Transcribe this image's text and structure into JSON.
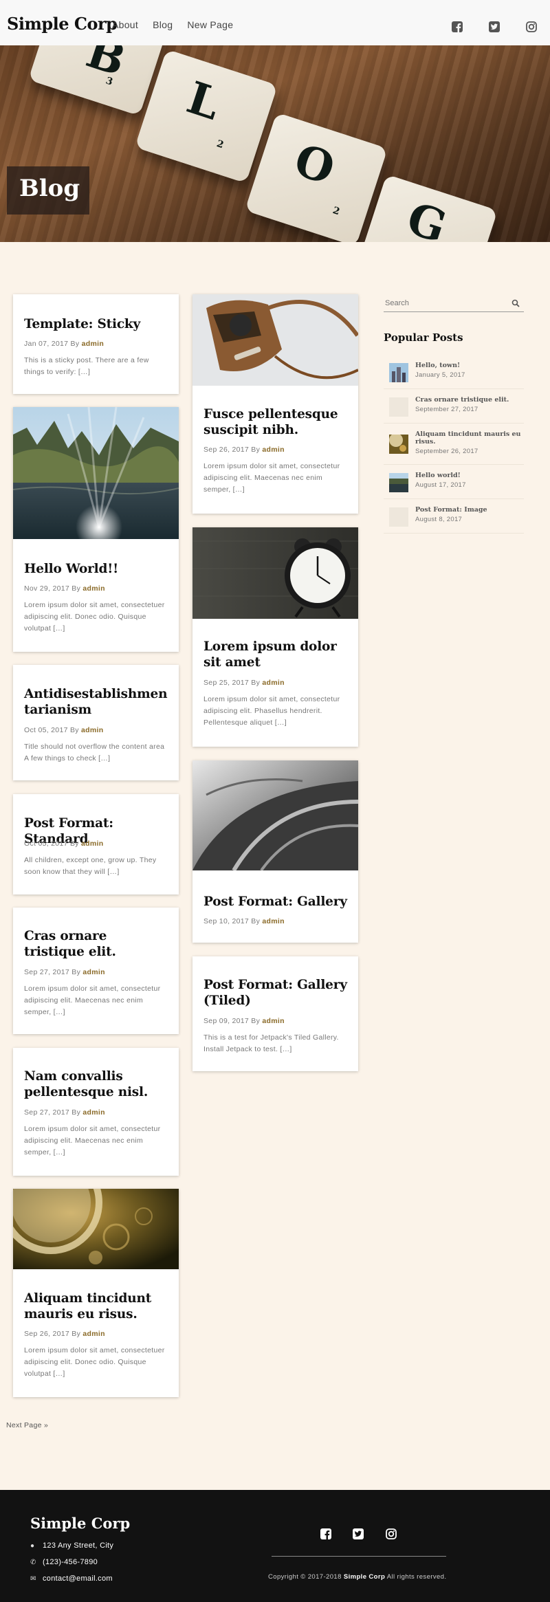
{
  "header": {
    "brand": "Simple Corp",
    "nav": [
      "About",
      "Blog",
      "New Page"
    ],
    "social_icons": [
      "facebook-icon",
      "twitter-icon",
      "instagram-icon"
    ]
  },
  "hero": {
    "title": "Blog",
    "tile_letters": [
      "B",
      "L",
      "O",
      "G"
    ],
    "tile_numbers": [
      "3",
      "2",
      "2",
      ""
    ]
  },
  "posts_left": [
    {
      "title": "Template: Sticky",
      "date": "Jan 07, 2017",
      "by": "By",
      "author": "admin",
      "excerpt": "This is a sticky post. There are a few things to verify: […]"
    },
    {
      "title": "Hello World!!",
      "date": "Nov 29, 2017",
      "by": "By",
      "author": "admin",
      "excerpt": "Lorem ipsum dolor sit amet, consectetuer adipiscing elit. Donec odio. Quisque volutpat […]"
    },
    {
      "title": "Antidisestablishmentarianism",
      "date": "Oct 05, 2017",
      "by": "By",
      "author": "admin",
      "excerpt": "Title should not overflow the content area A few things to check […]"
    },
    {
      "title": "Post Format: Standard",
      "date": "Oct 05, 2017",
      "by": "By",
      "author": "admin",
      "excerpt": "All children, except one, grow up. They soon know that they will […]"
    },
    {
      "title": "Cras ornare tristique elit.",
      "date": "Sep 27, 2017",
      "by": "By",
      "author": "admin",
      "excerpt": "Lorem ipsum dolor sit amet, consectetur adipiscing elit. Maecenas nec enim semper, […]"
    },
    {
      "title": "Nam convallis pellentesque nisl.",
      "date": "Sep 27, 2017",
      "by": "By",
      "author": "admin",
      "excerpt": "Lorem ipsum dolor sit amet, consectetur adipiscing elit. Maecenas nec enim semper, […]"
    },
    {
      "title": "Aliquam tincidunt mauris eu risus.",
      "date": "Sep 26, 2017",
      "by": "By",
      "author": "admin",
      "excerpt": "Lorem ipsum dolor sit amet, consectetuer adipiscing elit. Donec odio. Quisque volutpat […]"
    }
  ],
  "posts_right": [
    {
      "title": "Fusce pellentesque suscipit nibh.",
      "date": "Sep 26, 2017",
      "by": "By",
      "author": "admin",
      "excerpt": "Lorem ipsum dolor sit amet, consectetur adipiscing elit. Maecenas nec enim semper, […]"
    },
    {
      "title": "Lorem ipsum dolor sit amet",
      "date": "Sep 25, 2017",
      "by": "By",
      "author": "admin",
      "excerpt": "Lorem ipsum dolor sit amet, consectetur adipiscing elit. Phasellus hendrerit. Pellentesque aliquet […]"
    },
    {
      "title": "Post Format: Gallery",
      "date": "Sep 10, 2017",
      "by": "By",
      "author": "admin"
    },
    {
      "title": "Post Format: Gallery (Tiled)",
      "date": "Sep 09, 2017",
      "by": "By",
      "author": "admin",
      "excerpt": "This is a test for Jetpack's Tiled Gallery. Install Jetpack to test. […]"
    }
  ],
  "pagination": {
    "next": "Next Page »"
  },
  "sidebar": {
    "search_placeholder": "Search",
    "popular_title": "Popular Posts",
    "popular": [
      {
        "title": "Hello, town!",
        "date": "January 5, 2017"
      },
      {
        "title": "Cras ornare tristique elit.",
        "date": "September 27, 2017"
      },
      {
        "title": "Aliquam tincidunt mauris eu risus.",
        "date": "September 26, 2017"
      },
      {
        "title": "Hello world!",
        "date": "August 17, 2017"
      },
      {
        "title": "Post Format: Image",
        "date": "August 8, 2017"
      }
    ]
  },
  "footer": {
    "brand": "Simple Corp",
    "address": "123 Any Street, City",
    "phone": "(123)-456-7890",
    "email": "contact@email.com",
    "copyright_prefix": "Copyright © 2017-2018",
    "copyright_brand": "Simple Corp",
    "copyright_suffix": "All rights reserved."
  }
}
